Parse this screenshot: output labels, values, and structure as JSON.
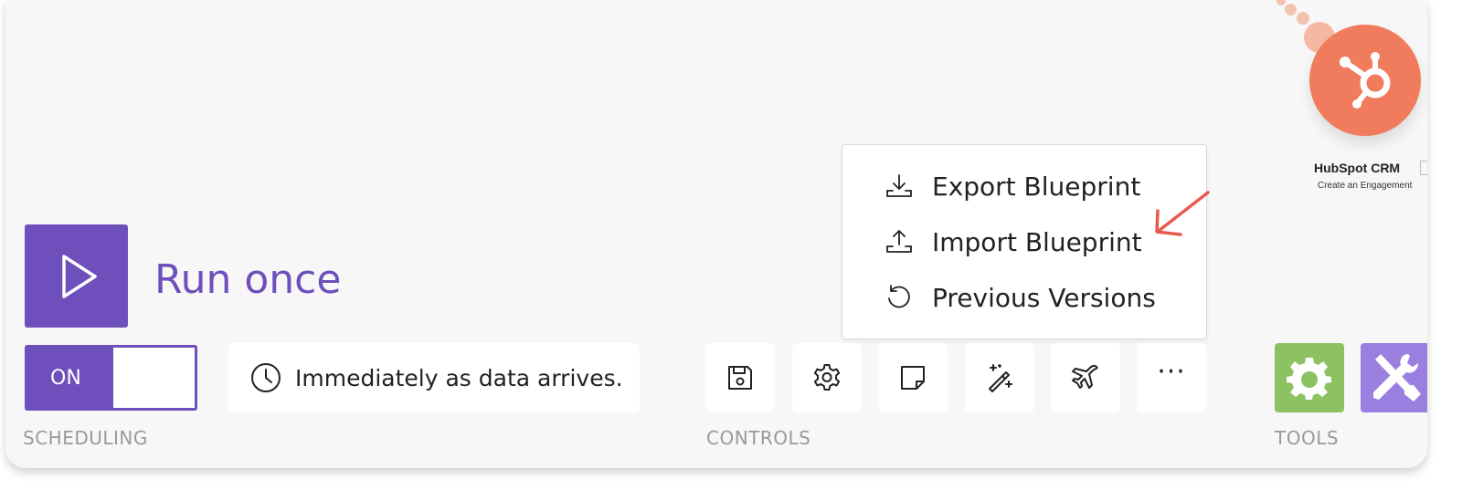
{
  "module": {
    "title": "HubSpot CRM",
    "subtitle": "Create an Engagement",
    "icon": "hubspot-sprocket-icon",
    "color": "#f07c5d"
  },
  "menu": {
    "items": [
      {
        "label": "Export Blueprint",
        "icon": "download-tray-icon"
      },
      {
        "label": "Import Blueprint",
        "icon": "upload-tray-icon"
      },
      {
        "label": "Previous Versions",
        "icon": "history-icon"
      }
    ]
  },
  "run": {
    "label": "Run once",
    "icon": "play-icon"
  },
  "scheduling": {
    "toggle_label": "ON",
    "schedule_text": "Immediately as data arrives.",
    "section_label": "SCHEDULING"
  },
  "controls": {
    "section_label": "CONTROLS",
    "buttons": [
      {
        "name": "save",
        "icon": "floppy-disk-icon"
      },
      {
        "name": "settings",
        "icon": "gear-icon"
      },
      {
        "name": "notes",
        "icon": "sticky-note-icon"
      },
      {
        "name": "auto-align",
        "icon": "magic-wand-icon"
      },
      {
        "name": "explain-flow",
        "icon": "airplane-icon"
      },
      {
        "name": "more",
        "icon": "ellipsis-icon",
        "label": "···"
      }
    ]
  },
  "tools": {
    "section_label": "TOOLS",
    "items": [
      {
        "icon": "gear-icon",
        "color": "#8cc262"
      },
      {
        "icon": "wrench-screwdriver-icon",
        "color": "#9b7fe0"
      }
    ]
  },
  "colors": {
    "accent": "#6e4fbb",
    "annotation_arrow": "#e85a4f"
  }
}
